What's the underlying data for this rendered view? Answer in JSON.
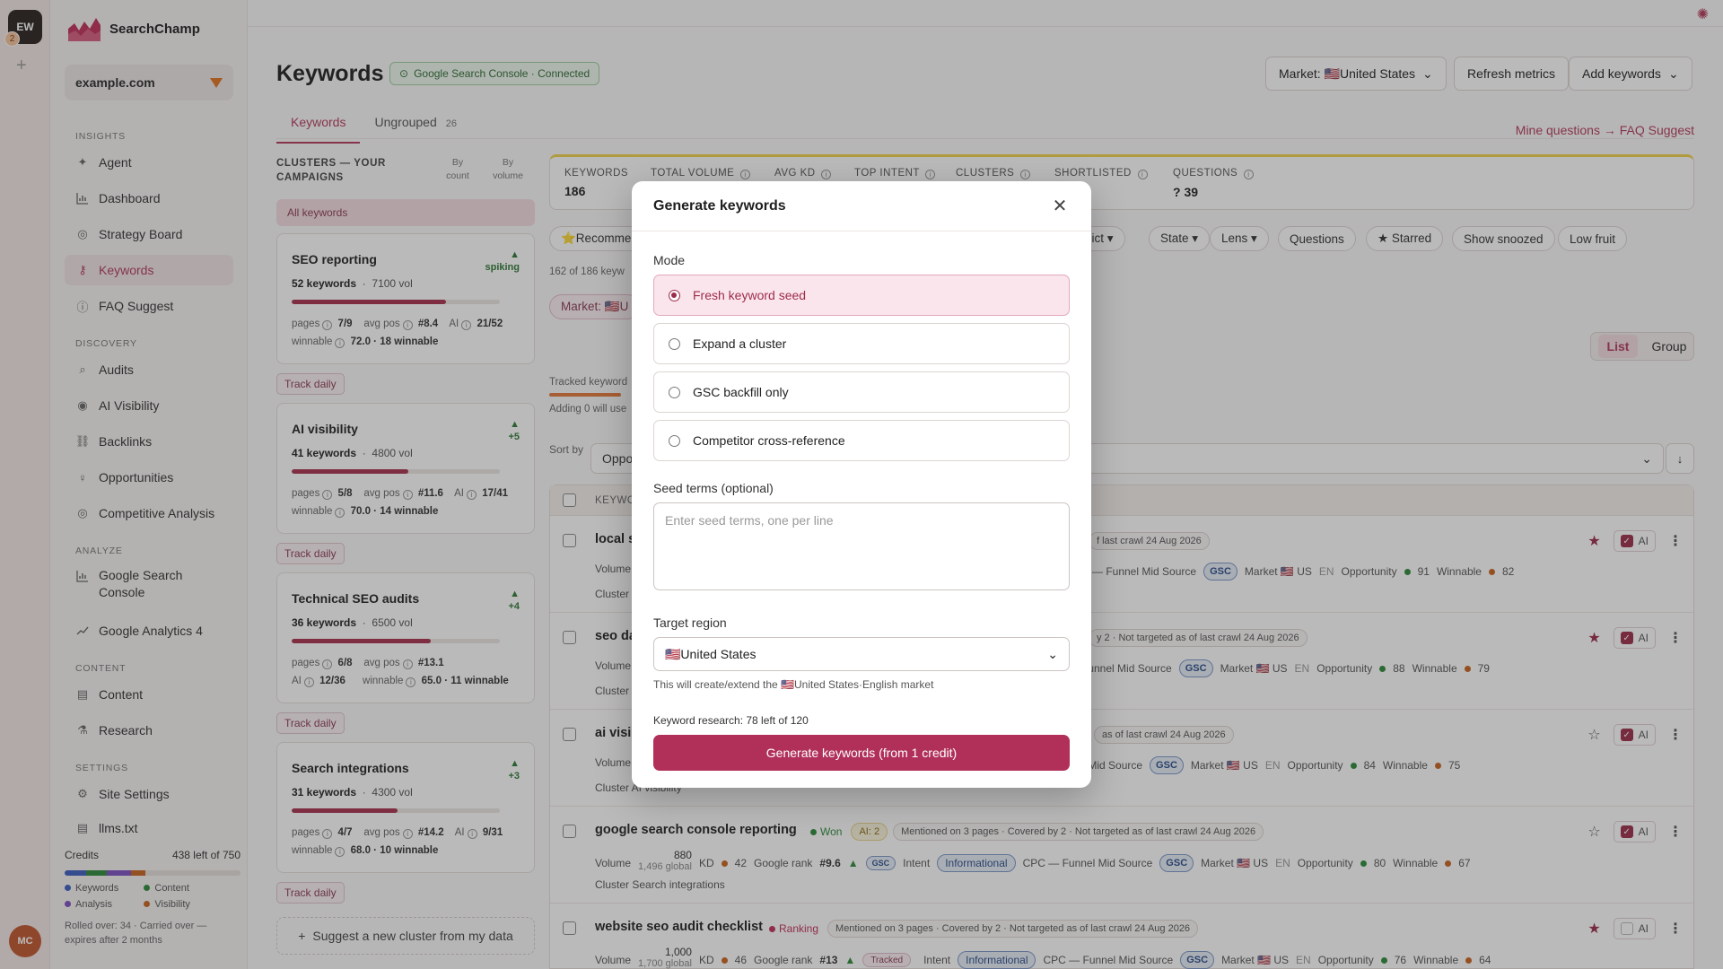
{
  "rail": {
    "workspace": "EW",
    "badge": "2",
    "user": "MC"
  },
  "brand": {
    "name": "SearchChamp"
  },
  "site": {
    "name": "example.com"
  },
  "sections": {
    "insights": "INSIGHTS",
    "discovery": "DISCOVERY",
    "analyze": "ANALYZE",
    "content": "CONTENT",
    "settings": "SETTINGS"
  },
  "nav": {
    "agent": "Agent",
    "dashboard": "Dashboard",
    "strategy": "Strategy Board",
    "keywords": "Keywords",
    "faq": "FAQ Suggest",
    "audits": "Audits",
    "ai_visibility": "AI Visibility",
    "backlinks": "Backlinks",
    "opportunities": "Opportunities",
    "competitive": "Competitive Analysis",
    "gsc": "Google Search Console",
    "ga4": "Google Analytics 4",
    "content": "Content",
    "research": "Research",
    "site_settings": "Site Settings",
    "llms": "llms.txt"
  },
  "credits": {
    "label": "Credits",
    "value": "438 left of 750",
    "legend": [
      "Keywords",
      "Content",
      "Analysis",
      "Visibility"
    ],
    "legend_colors": [
      "#3b5fc0",
      "#2f8a3c",
      "#7b4fc2",
      "#c9631f"
    ],
    "note": "Rolled over: 34 · Carried over — expires after 2 months"
  },
  "header": {
    "title": "Keywords",
    "gsc_status": "Google Search Console · Connected",
    "market_btn": "Market: 🇺🇸United States",
    "refresh_btn": "Refresh metrics",
    "add_btn": "Add keywords",
    "faq_link": "Mine questions → FAQ Suggest"
  },
  "tabs": [
    {
      "label": "Keywords",
      "count": ""
    },
    {
      "label": "Ungrouped",
      "count": "26"
    }
  ],
  "clusters": {
    "title": "CLUSTERS — YOUR CAMPAIGNS",
    "sort_count": "By count",
    "sort_volume": "By volume",
    "all": "All keywords",
    "track_label": "Track daily",
    "suggest": "Suggest a new cluster from my data",
    "items": [
      {
        "name": "SEO reporting",
        "trend": "spiking",
        "keywords": "52 keywords",
        "vol": "7100 vol",
        "fill": 0.74,
        "l1": {
          "pages": "7/9",
          "avg_pos": "#8.4",
          "ai": "21/52"
        },
        "l2": {
          "winnable": "72.0 · 18 winnable"
        }
      },
      {
        "name": "AI visibility",
        "trend": "+5",
        "keywords": "41 keywords",
        "vol": "4800 vol",
        "fill": 0.56,
        "l1": {
          "pages": "5/8",
          "avg_pos": "#11.6",
          "ai": "17/41"
        },
        "l2": {
          "winnable": "70.0 · 14 winnable"
        }
      },
      {
        "name": "Technical SEO audits",
        "trend": "+4",
        "keywords": "36 keywords",
        "vol": "6500 vol",
        "fill": 0.67,
        "l1": {
          "pages": "6/8",
          "avg_pos": "#13.1",
          "ai": "12/36"
        },
        "l2": {
          "winnable": "65.0 · 11 winnable"
        }
      },
      {
        "name": "Search integrations",
        "trend": "+3",
        "keywords": "31 keywords",
        "vol": "4300 vol",
        "fill": 0.51,
        "l1": {
          "pages": "4/7",
          "avg_pos": "#14.2",
          "ai": "9/31"
        },
        "l2": {
          "winnable": "68.0 · 10 winnable"
        }
      }
    ],
    "labels": {
      "pages": "pages",
      "avg_pos": "avg pos",
      "ai": "AI",
      "winnable": "winnable"
    }
  },
  "stats": [
    {
      "label": "KEYWORDS",
      "value": "186"
    },
    {
      "label": "TOTAL VOLUME",
      "value": ""
    },
    {
      "label": "AVG KD",
      "value": ""
    },
    {
      "label": "TOP INTENT",
      "value": ""
    },
    {
      "label": "CLUSTERS",
      "value": ""
    },
    {
      "label": "SHORTLISTED",
      "value": ""
    },
    {
      "label": "QUESTIONS",
      "value": "? 39"
    }
  ],
  "filters": {
    "recommended": "⭐Recomme",
    "dict": "dict ▾",
    "state": "State ▾",
    "lens": "Lens ▾",
    "questions": "Questions",
    "starred": "★ Starred",
    "snoozed": "Show snoozed",
    "low_fruit": "Low fruit",
    "count": "162 of 186 keyw",
    "market": "Market: 🇺🇸U"
  },
  "view": {
    "list": "List",
    "group": "Group"
  },
  "tracked": {
    "label": "Tracked keyword",
    "adding": "Adding 0 will use"
  },
  "sort": {
    "label": "Sort by",
    "value": "Oppo"
  },
  "table": {
    "header": "KEYWO",
    "rows": [
      {
        "kw": "local s",
        "tags": [
          "f last crawl 24 Aug 2026"
        ],
        "line2": "Volume",
        "line2b": "C —  Funnel Mid  Source",
        "gsc": "GSC",
        "market": "Market 🇺🇸 US",
        "lang": "EN",
        "opp": "Opportunity",
        "opp_v": "91",
        "win": "Winnable",
        "win_v": "82",
        "line3": "Cluster",
        "starred": true
      },
      {
        "kw": "seo da",
        "tags": [
          "y 2 · Not targeted  as of last crawl 24 Aug 2026"
        ],
        "line2": "Volume",
        "line2b": "Funnel Mid  Source",
        "gsc": "GSC",
        "market": "Market 🇺🇸 US",
        "lang": "EN",
        "opp": "Opportunity",
        "opp_v": "88",
        "win": "Winnable",
        "win_v": "79",
        "line3": "Cluster",
        "starred": true
      },
      {
        "kw": "ai visil",
        "tags": [
          "as of last crawl 24 Aug 2026"
        ],
        "line2": "Volume",
        "line2b": "nel Mid  Source",
        "gsc": "GSC",
        "market": "Market 🇺🇸 US",
        "lang": "EN",
        "opp": "Opportunity",
        "opp_v": "84",
        "win": "Winnable",
        "win_v": "75",
        "line3": "Cluster AI visibility",
        "starred": false
      },
      {
        "kw": "google search console reporting",
        "status": "Won",
        "ai_tag": "AI: 2",
        "tags": [
          "Mentioned on 3 pages · Covered by 2 · Not targeted  as of last crawl 24 Aug 2026"
        ],
        "line2": "Volume",
        "vol": "880",
        "global": "1,496 global",
        "kd": "KD",
        "kd_v": "42",
        "rank": "Google rank",
        "rank_v": "#9.6",
        "intent": "Intent",
        "intent_v": "Informational",
        "cpc": "CPC —  Funnel Mid  Source",
        "gsc": "GSC",
        "market": "Market 🇺🇸 US",
        "lang": "EN",
        "opp": "Opportunity",
        "opp_v": "80",
        "win": "Winnable",
        "win_v": "67",
        "line3": "Cluster Search integrations",
        "starred": false
      },
      {
        "kw": "website seo audit checklist",
        "status": "Ranking",
        "tags": [
          "Mentioned on 3 pages · Covered by 2 · Not targeted  as of last crawl 24 Aug 2026"
        ],
        "line2": "Volume",
        "vol": "1,000",
        "global": "1,700 global",
        "kd": "KD",
        "kd_v": "46",
        "rank": "Google rank",
        "rank_v": "#13",
        "tracked": "Tracked",
        "intent": "Intent",
        "intent_v": "Informational",
        "cpc": "CPC —  Funnel Mid  Source",
        "gsc": "GSC",
        "market": "Market 🇺🇸 US",
        "lang": "EN",
        "opp": "Opportunity",
        "opp_v": "76",
        "win": "Winnable",
        "win_v": "64",
        "starred": true
      }
    ],
    "ai_label": "AI"
  },
  "modal": {
    "title": "Generate keywords",
    "mode_label": "Mode",
    "options": [
      "Fresh keyword seed",
      "Expand a cluster",
      "GSC backfill only",
      "Competitor cross-reference"
    ],
    "selected": 0,
    "seed_label": "Seed terms (optional)",
    "seed_placeholder": "Enter seed terms, one per line",
    "region_label": "Target region",
    "region_value": "🇺🇸United States",
    "region_help": "This will create/extend the 🇺🇸United States·English market",
    "quota": "Keyword research: 78 left of 120",
    "cta": "Generate keywords (from 1 credit)"
  }
}
